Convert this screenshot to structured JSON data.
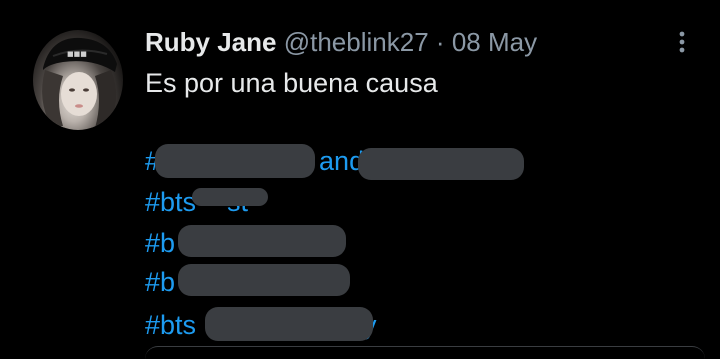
{
  "tweet": {
    "author_name": "Ruby Jane",
    "author_handle": "@theblink27",
    "separator": "·",
    "date": "08 May",
    "text": "Es por una buena causa",
    "hashtags": [
      {
        "visible_start": "#",
        "visible_end": "and"
      },
      {
        "visible_start": "#bts",
        "visible_end": "st"
      },
      {
        "visible_start": "#b",
        "visible_end": ""
      },
      {
        "visible_start": "#b",
        "visible_end": ""
      },
      {
        "visible_start": "#bts",
        "visible_end": "y"
      }
    ]
  },
  "icons": {
    "more": "more-vertical-icon",
    "avatar": "avatar-image"
  },
  "colors": {
    "background": "#000000",
    "text_primary": "#e7e9ea",
    "text_secondary": "#8b98a5",
    "link": "#1d9bf0",
    "redaction": "#3a3d41"
  }
}
